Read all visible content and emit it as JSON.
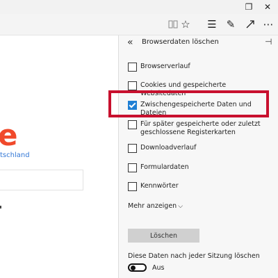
{
  "window": {
    "restore_glyph": "❐",
    "close_glyph": "✕"
  },
  "toolbar": {
    "icons": [
      "reading-view-icon",
      "favorite-star-icon",
      "hub-icon",
      "web-note-icon",
      "more-icon"
    ],
    "reading_glyph": "📖",
    "star_glyph": "☆",
    "hub_glyph": "☰",
    "note_glyph": "✎",
    "more_glyph": "⋯"
  },
  "page": {
    "logo_fragment": "e",
    "country_link": "tschland"
  },
  "panel": {
    "title": "Browserdaten löschen",
    "back_glyph": "«",
    "pin_glyph": "⊣",
    "options": [
      {
        "label": "Browserverlauf",
        "checked": false
      },
      {
        "label": "Cookies und gespeicherte Websitedaten",
        "checked": false
      },
      {
        "label": "Zwischengespeicherte Daten und Dateien",
        "checked": true
      },
      {
        "label": "Für später gespeicherte oder zuletzt geschlossene Registerkarten",
        "checked": false
      },
      {
        "label": "Downloadverlauf",
        "checked": false
      },
      {
        "label": "Formulardaten",
        "checked": false
      },
      {
        "label": "Kennwörter",
        "checked": false
      }
    ],
    "more_label": "Mehr anzeigen",
    "clear_button": "Löschen",
    "after_session_label": "Diese Daten nach jeder Sitzung löschen",
    "toggle_label": "Aus",
    "toggle_on": false
  },
  "colors": {
    "accent": "#1f7fd4",
    "highlight": "#c8102e",
    "logo": "#f0492b",
    "link": "#3378d6"
  }
}
